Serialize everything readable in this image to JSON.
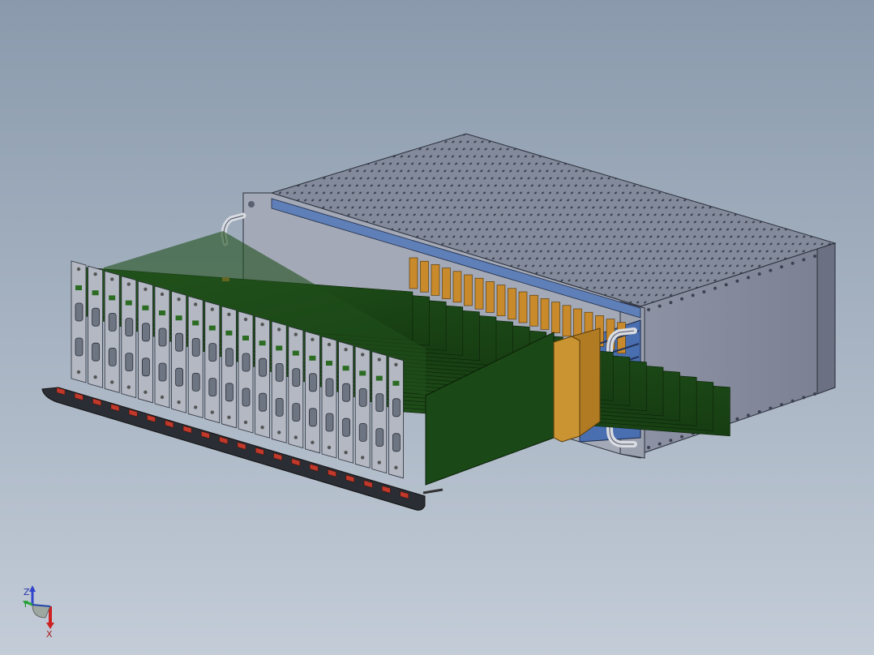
{
  "viewport": {
    "background_top": "#8a9aac",
    "background_bottom": "#c3ccd7"
  },
  "model": {
    "card_count": 20,
    "colors": {
      "chassis_side": "#8f95a6",
      "chassis_top": "#7f8596",
      "front_panel": "#a8aebb",
      "pcb_green": "#1f4d1a",
      "connector_orange": "#c88a2a",
      "backplane_blue": "#4a6fb0",
      "ejector_red": "#c0392b"
    },
    "handles": [
      "left-handle-icon",
      "right-handle-icon"
    ]
  },
  "triad": {
    "z_label": "Z",
    "y_label": "Y",
    "x_label": "X",
    "z_color": "#3344cc",
    "y_color": "#22aa33",
    "x_color": "#cc2222"
  }
}
